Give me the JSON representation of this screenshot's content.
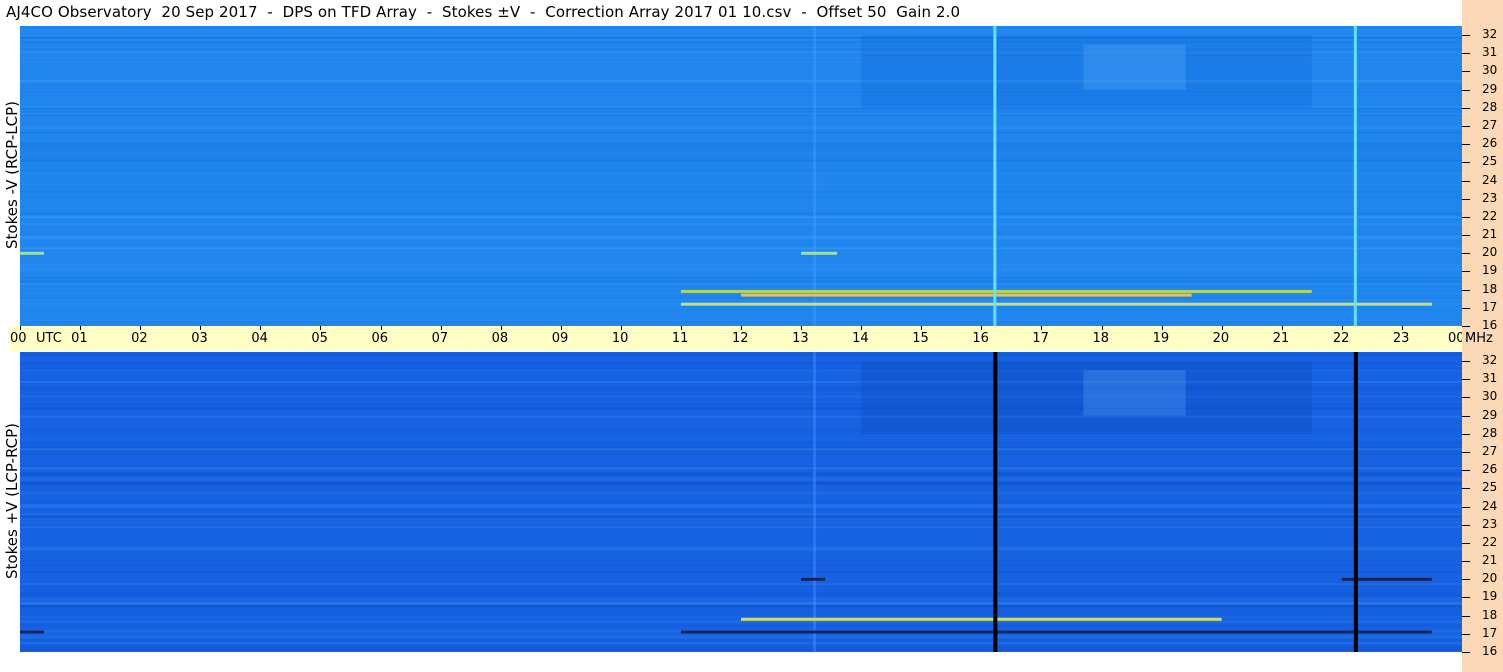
{
  "title": "AJ4CO Observatory  20 Sep 2017  -  DPS on TFD Array  -  Stokes ±V  -  Correction Array 2017 01 10.csv  -  Offset 50  Gain 2.0",
  "colors": {
    "top_bg": "#1f86f0",
    "bottom_bg": "#1662e3",
    "timebar": "#ffffc6",
    "freq_scale": "#fcd9b6"
  },
  "chart_data": [
    {
      "type": "heatmap",
      "ylabel": "Stokes -V (RCP-LCP)",
      "x_ticks": [
        "00",
        "01",
        "02",
        "03",
        "04",
        "05",
        "06",
        "07",
        "08",
        "09",
        "10",
        "11",
        "12",
        "13",
        "14",
        "15",
        "16",
        "17",
        "18",
        "19",
        "20",
        "21",
        "22",
        "23",
        "00"
      ],
      "x_unit": "UTC",
      "xlim_hours": [
        0,
        24
      ],
      "y_ticks": [
        16,
        17,
        18,
        19,
        20,
        21,
        22,
        23,
        24,
        25,
        26,
        27,
        28,
        29,
        30,
        31,
        32
      ],
      "y_unit": "MHz",
      "ylim_mhz": [
        16,
        32.5
      ],
      "vertical_lines_hours": [
        16.2,
        22.2
      ],
      "vertical_line_color": "#66e0ff",
      "emission_bands": [
        {
          "start_hour": 11.0,
          "end_hour": 21.5,
          "mhz": 17.9,
          "color": "#c8e050"
        },
        {
          "start_hour": 12.0,
          "end_hour": 19.5,
          "mhz": 17.7,
          "color": "#ffd040"
        },
        {
          "start_hour": 11.0,
          "end_hour": 23.5,
          "mhz": 17.2,
          "color": "#e8f060"
        },
        {
          "start_hour": 13.0,
          "end_hour": 13.6,
          "mhz": 20.0,
          "color": "#b0f0a0"
        },
        {
          "start_hour": 0.0,
          "end_hour": 0.4,
          "mhz": 20.0,
          "color": "#b0f0a0"
        }
      ]
    },
    {
      "type": "heatmap",
      "ylabel": "Stokes +V (LCP-RCP)",
      "x_ticks": [
        "00",
        "01",
        "02",
        "03",
        "04",
        "05",
        "06",
        "07",
        "08",
        "09",
        "10",
        "11",
        "12",
        "13",
        "14",
        "15",
        "16",
        "17",
        "18",
        "19",
        "20",
        "21",
        "22",
        "23",
        "00"
      ],
      "x_unit": "UTC",
      "xlim_hours": [
        0,
        24
      ],
      "y_ticks": [
        16,
        17,
        18,
        19,
        20,
        21,
        22,
        23,
        24,
        25,
        26,
        27,
        28,
        29,
        30,
        31,
        32
      ],
      "y_unit": "MHz",
      "ylim_mhz": [
        16,
        32.5
      ],
      "vertical_lines_hours": [
        16.2,
        22.2
      ],
      "vertical_line_color": "#000000",
      "emission_bands": [
        {
          "start_hour": 12.0,
          "end_hour": 20.0,
          "mhz": 17.8,
          "color": "#f0f060"
        },
        {
          "start_hour": 11.0,
          "end_hour": 23.5,
          "mhz": 17.1,
          "color": "#101840"
        },
        {
          "start_hour": 13.0,
          "end_hour": 13.4,
          "mhz": 20.0,
          "color": "#101840"
        },
        {
          "start_hour": 22.0,
          "end_hour": 23.5,
          "mhz": 20.0,
          "color": "#101840"
        },
        {
          "start_hour": 0.0,
          "end_hour": 0.4,
          "mhz": 17.1,
          "color": "#101840"
        }
      ]
    }
  ]
}
